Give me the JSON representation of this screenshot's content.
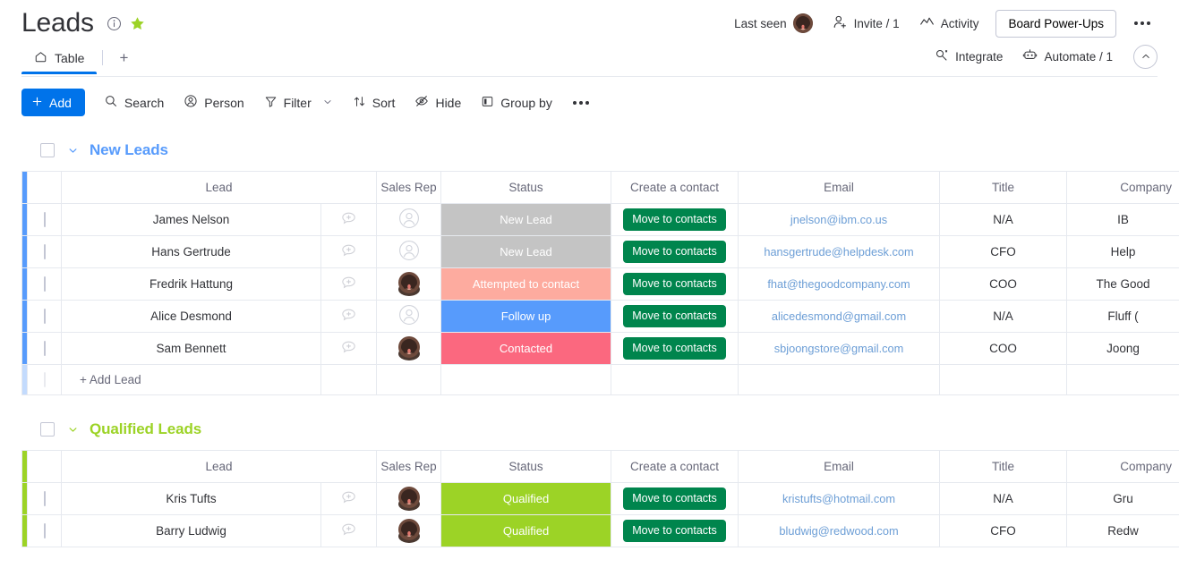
{
  "header": {
    "title": "Leads",
    "info_icon": "info-circle-icon",
    "star_icon": "star-icon",
    "last_seen_label": "Last seen",
    "invite_label": "Invite / 1",
    "activity_label": "Activity",
    "power_ups_label": "Board Power-Ups",
    "more_label": "•••",
    "integrate_label": "Integrate",
    "automate_label": "Automate / 1",
    "collapse_icon": "chevron-up-icon"
  },
  "tabs": {
    "items": [
      {
        "label": "Table",
        "icon": "home-icon",
        "active": true
      }
    ],
    "add_label": "+"
  },
  "toolbar": {
    "add_label": "Add",
    "search_label": "Search",
    "person_label": "Person",
    "filter_label": "Filter",
    "sort_label": "Sort",
    "hide_label": "Hide",
    "group_by_label": "Group by",
    "more_label": "•••"
  },
  "colors": {
    "accent_blue": "#0073ea",
    "group_new_leads": "#579bfc",
    "group_qualified": "#9cd326",
    "status_new_lead": "#c4c4c4",
    "status_attempted": "#fdab9f",
    "status_follow_up": "#579bfc",
    "status_contacted": "#fb687f",
    "status_qualified": "#9cd326",
    "move_button": "#00854d",
    "email_link": "#6c9ed6",
    "star": "#9cd326"
  },
  "columns": [
    "Lead",
    "Sales Rep",
    "Status",
    "Create a contact",
    "Email",
    "Title",
    "Company"
  ],
  "groups": [
    {
      "name": "New Leads",
      "color": "#579bfc",
      "add_row_label": "+ Add Lead",
      "rows": [
        {
          "lead": "James Nelson",
          "has_avatar": false,
          "status": "New Lead",
          "status_color": "#c4c4c4",
          "contact_button": "Move to contacts",
          "email": "jnelson@ibm.co.us",
          "title": "N/A",
          "company": "IB"
        },
        {
          "lead": "Hans Gertrude",
          "has_avatar": false,
          "status": "New Lead",
          "status_color": "#c4c4c4",
          "contact_button": "Move to contacts",
          "email": "hansgertrude@helpdesk.com",
          "title": "CFO",
          "company": "Help"
        },
        {
          "lead": "Fredrik Hattung",
          "has_avatar": true,
          "status": "Attempted to contact",
          "status_color": "#fdab9f",
          "contact_button": "Move to contacts",
          "email": "fhat@thegoodcompany.com",
          "title": "COO",
          "company": "The Good"
        },
        {
          "lead": "Alice Desmond",
          "has_avatar": false,
          "status": "Follow up",
          "status_color": "#579bfc",
          "contact_button": "Move to contacts",
          "email": "alicedesmond@gmail.com",
          "title": "N/A",
          "company": "Fluff ("
        },
        {
          "lead": "Sam Bennett",
          "has_avatar": true,
          "status": "Contacted",
          "status_color": "#fb687f",
          "contact_button": "Move to contacts",
          "email": "sbjoongstore@gmail.com",
          "title": "COO",
          "company": "Joong"
        }
      ]
    },
    {
      "name": "Qualified Leads",
      "color": "#9cd326",
      "rows": [
        {
          "lead": "Kris Tufts",
          "has_avatar": true,
          "status": "Qualified",
          "status_color": "#9cd326",
          "contact_button": "Move to contacts",
          "email": "kristufts@hotmail.com",
          "title": "N/A",
          "company": "Gru"
        },
        {
          "lead": "Barry Ludwig",
          "has_avatar": true,
          "status": "Qualified",
          "status_color": "#9cd326",
          "contact_button": "Move to contacts",
          "email": "bludwig@redwood.com",
          "title": "CFO",
          "company": "Redw"
        }
      ]
    }
  ]
}
